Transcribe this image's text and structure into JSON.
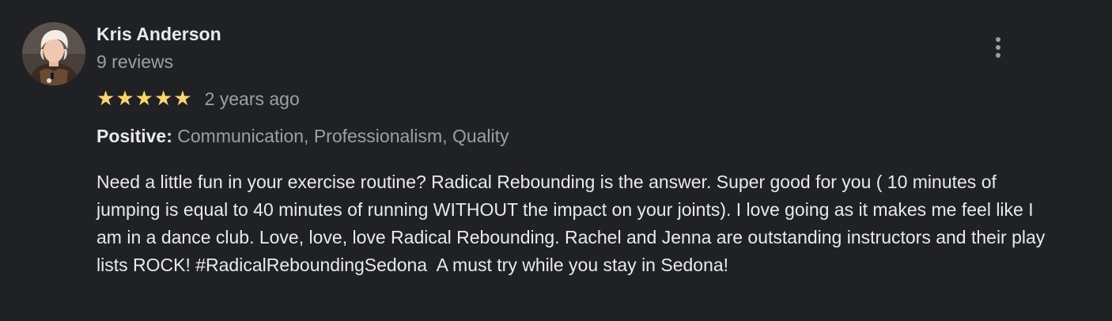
{
  "reviewer": {
    "name": "Kris Anderson",
    "review_count": "9 reviews",
    "avatar": "profile-photo"
  },
  "more_menu": {
    "icon": "more-vert-icon"
  },
  "rating": {
    "stars": 5,
    "max_stars": 5,
    "star_glyph": "★",
    "star_color": "#fdd663",
    "time_ago": "2 years ago"
  },
  "attributes": {
    "label": "Positive:",
    "values": "Communication, Professionalism, Quality"
  },
  "review": {
    "text": "Need a little fun in your exercise routine? Radical Rebounding is the answer. Super good for you ( 10 minutes of jumping is equal to 40 minutes of running WITHOUT the impact on your joints). I love going as it makes me feel like I am in a dance club. Love, love, love Radical Rebounding. Rachel and Jenna are outstanding instructors and their play lists ROCK! #RadicalReboundingSedona  A must try while you stay in Sedona!"
  },
  "colors": {
    "background": "#202124",
    "primary_text": "#e8eaed",
    "secondary_text": "#9aa0a6"
  }
}
